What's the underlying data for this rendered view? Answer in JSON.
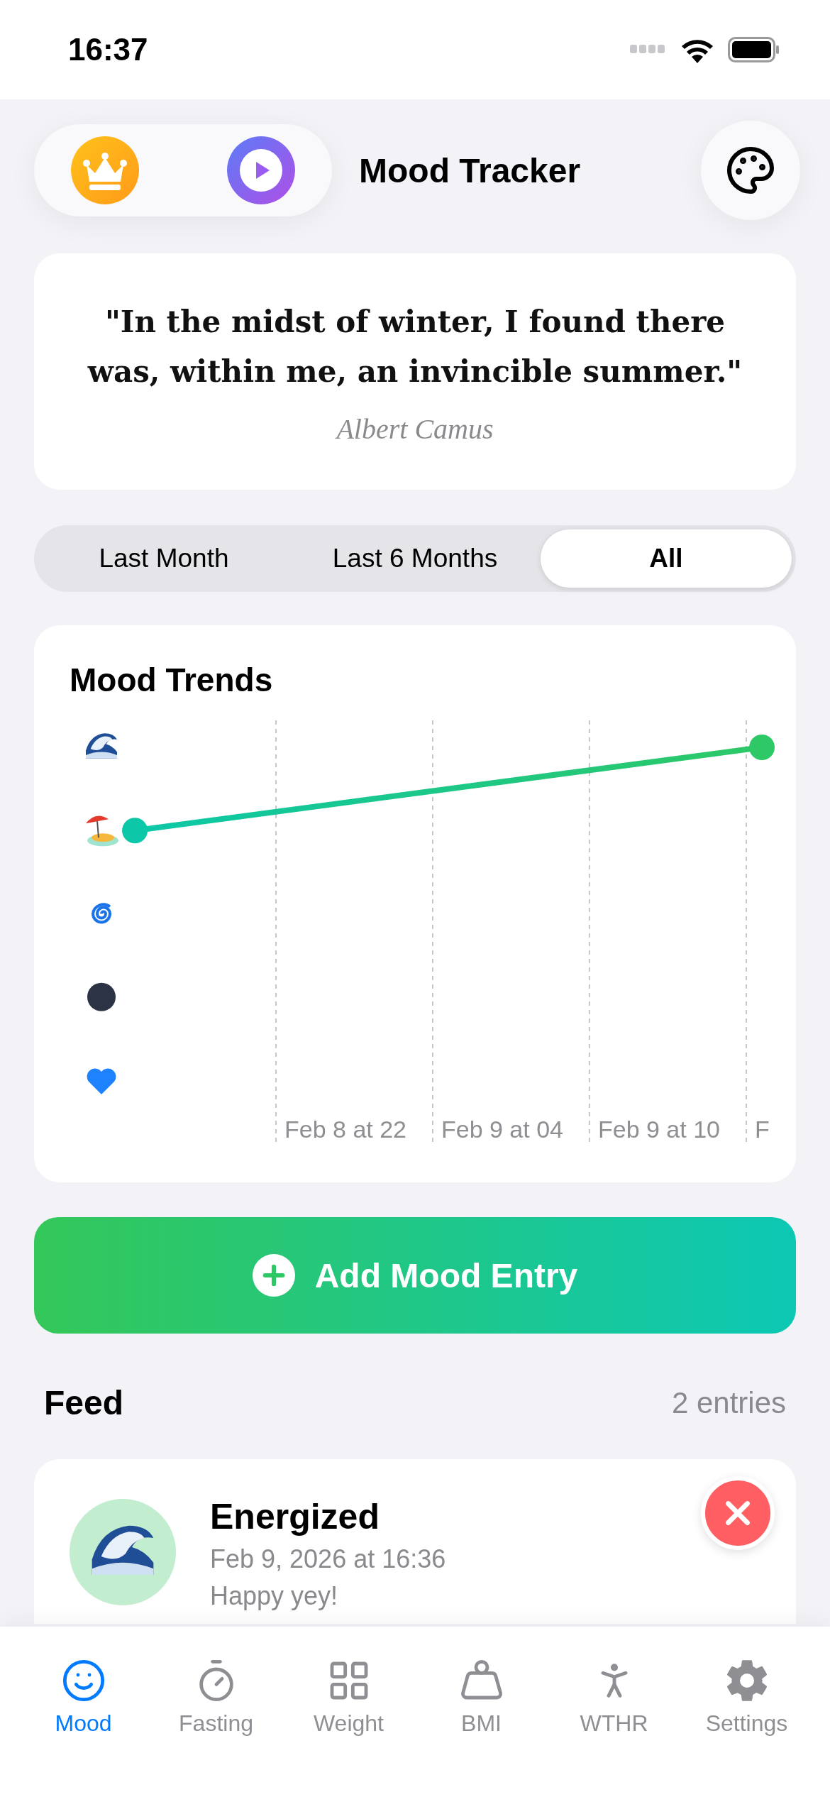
{
  "status_bar": {
    "time": "16:37"
  },
  "header": {
    "title": "Mood Tracker"
  },
  "quote": {
    "text": "\"In the midst of winter, I found there was, within me, an invincible summer.\"",
    "author": "Albert Camus"
  },
  "range_tabs": [
    {
      "label": "Last Month",
      "selected": false
    },
    {
      "label": "Last 6 Months",
      "selected": false
    },
    {
      "label": "All",
      "selected": true
    }
  ],
  "chart": {
    "title": "Mood Trends",
    "time_labels": [
      "Feb 8 at 22",
      "Feb 9 at 04",
      "Feb 9 at 10",
      "F"
    ]
  },
  "add_button": {
    "label": "Add Mood Entry"
  },
  "feed": {
    "title": "Feed",
    "count": "2 entries",
    "entries": [
      {
        "mood": "Energized",
        "date": "Feb 9, 2026 at 16:36",
        "note": "Happy yey!"
      }
    ]
  },
  "tab_bar": [
    {
      "label": "Mood",
      "kind": "mood",
      "selected": true
    },
    {
      "label": "Fasting",
      "kind": "fasting",
      "selected": false
    },
    {
      "label": "Weight",
      "kind": "weight",
      "selected": false
    },
    {
      "label": "BMI",
      "kind": "bmi",
      "selected": false
    },
    {
      "label": "WTHR",
      "kind": "wthr",
      "selected": false
    },
    {
      "label": "Settings",
      "kind": "settings",
      "selected": false
    }
  ]
}
